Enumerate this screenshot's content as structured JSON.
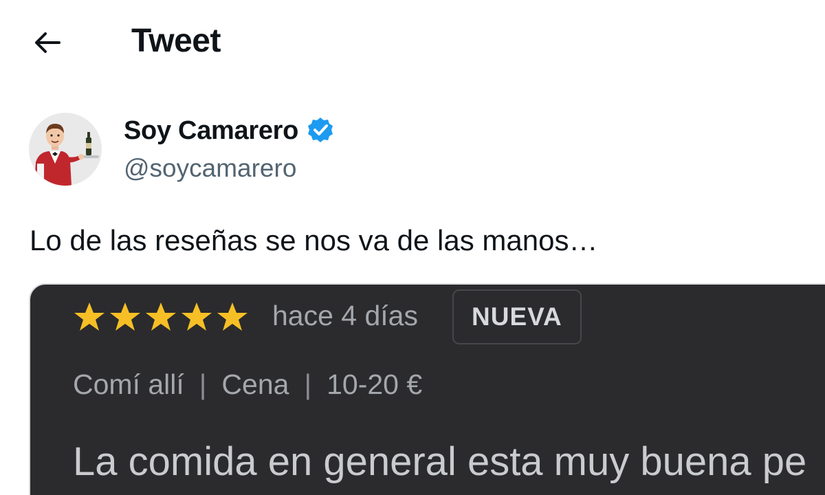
{
  "header": {
    "back_icon": "arrow-left-icon",
    "title": "Tweet"
  },
  "author": {
    "name": "Soy Camarero",
    "handle": "@soycamarero",
    "verified": true,
    "verified_icon": "verified-badge-icon",
    "verified_color": "#1d9bf0"
  },
  "tweet": {
    "text": "Lo de las reseñas se nos va de las manos…"
  },
  "media": {
    "review": {
      "rating": 5,
      "rating_max": 5,
      "star_color": "#f6bf26",
      "date": "hace 4 días",
      "badge": "NUEVA",
      "meta": [
        "Comí allí",
        "Cena",
        "10-20 €"
      ],
      "meta_separator": "|",
      "body": "La comida en general esta muy buena pe"
    },
    "background": "#2b2b2d"
  }
}
